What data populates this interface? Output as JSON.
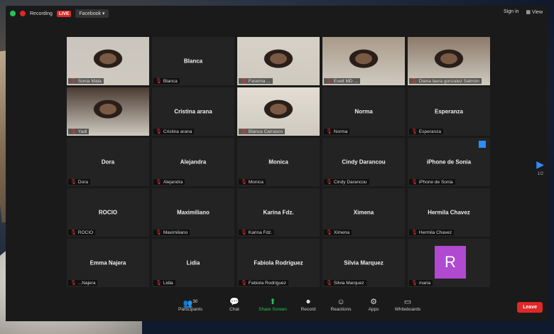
{
  "topbar": {
    "recording": "Recording",
    "live": "LIVE",
    "facebook": "Facebook ▾",
    "sign_in": "Sign in",
    "view": "View"
  },
  "tiles": [
    {
      "label": "Sonia Mata",
      "name": "",
      "video": true
    },
    {
      "label": "Blanca",
      "name": "Blanca",
      "video": false
    },
    {
      "label": "Fasema  ...",
      "name": "",
      "video": true
    },
    {
      "label": "Evett MD ...",
      "name": "",
      "video": true
    },
    {
      "label": "Diana laura gonzalez Salmón",
      "name": "",
      "video": true
    },
    {
      "label": "Yadi",
      "name": "",
      "video": true
    },
    {
      "label": "Cristina arana",
      "name": "Cristina arana",
      "video": false
    },
    {
      "label": "Blanca Carrasco",
      "name": "",
      "video": true,
      "active": true
    },
    {
      "label": "Norma",
      "name": "Norma",
      "video": false
    },
    {
      "label": "Esperanza",
      "name": "Esperanza",
      "video": false
    },
    {
      "label": "Dora",
      "name": "Dora",
      "video": false
    },
    {
      "label": "Alejandra",
      "name": "Alejandra",
      "video": false
    },
    {
      "label": "Monica",
      "name": "Monica",
      "video": false
    },
    {
      "label": "Cindy Darancou",
      "name": "Cindy Darancou",
      "video": false
    },
    {
      "label": "iPhone de Sonia",
      "name": "iPhone de Sonia",
      "video": false
    },
    {
      "label": "ROCIO",
      "name": "ROCIO",
      "video": false
    },
    {
      "label": "Maximiliano",
      "name": "Maximiliano",
      "video": false
    },
    {
      "label": "Karina Fdz.",
      "name": "Karina Fdz.",
      "video": false
    },
    {
      "label": "Ximena",
      "name": "Ximena",
      "video": false
    },
    {
      "label": "Hermila Chavez",
      "name": "Hermila Chavez",
      "video": false
    },
    {
      "label": "...Najera",
      "name": "Emma Najera",
      "video": false
    },
    {
      "label": "Lidia",
      "name": "Lidia",
      "video": false
    },
    {
      "label": "Fabiola Rodríguez",
      "name": "Fabiola Rodríguez",
      "video": false
    },
    {
      "label": "Silvia Marquez",
      "name": "Silvia Marquez",
      "video": false
    },
    {
      "label": "maria",
      "name": "",
      "video": false,
      "avatar": "R"
    }
  ],
  "pager": {
    "page": "1/2"
  },
  "toolbar": {
    "participants_count": "30",
    "participants": "Participants",
    "chat": "Chat",
    "share": "Share Screen",
    "record": "Record",
    "reactions": "Reactions",
    "apps": "Apps",
    "whiteboards": "Whiteboards",
    "leave": "Leave"
  },
  "colors": {
    "accent": "#2d8cff",
    "share": "#23c552",
    "leave": "#e02828",
    "active_border": "#c6e03a",
    "avatar": "#b04ad1"
  }
}
